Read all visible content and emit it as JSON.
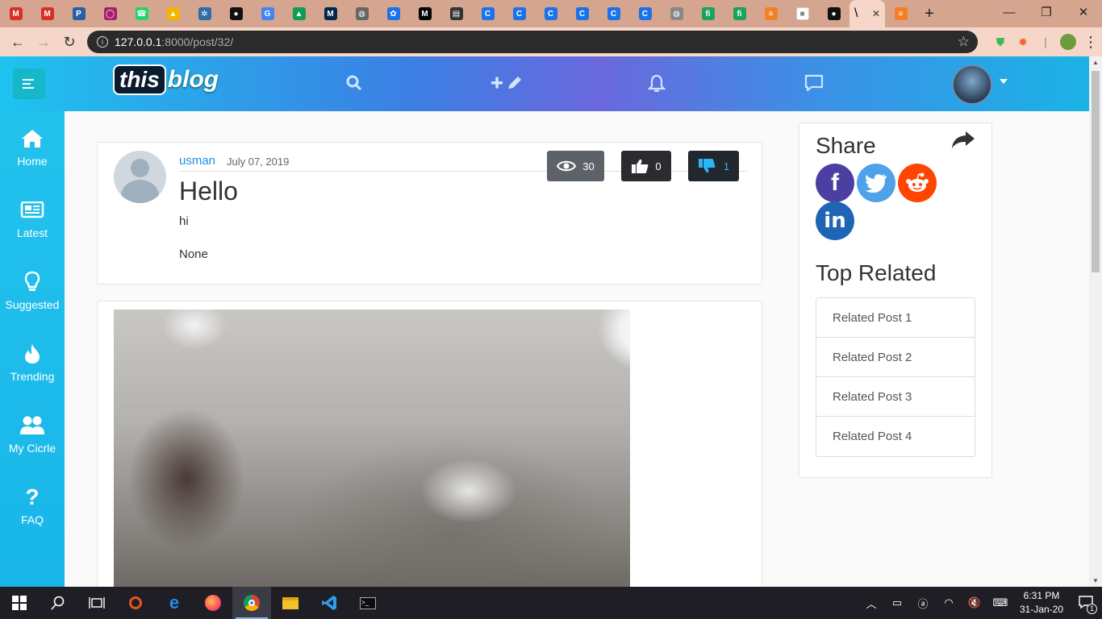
{
  "browser": {
    "tabs": [
      {
        "icon": "gmail-icon",
        "label": "M",
        "color": "#d93025"
      },
      {
        "icon": "gmail-icon",
        "label": "M",
        "color": "#d93025"
      },
      {
        "icon": "pastebin-icon",
        "label": "P",
        "color": "#2a5ea8"
      },
      {
        "icon": "circle-icon",
        "label": "◯",
        "color": "#a61e6c"
      },
      {
        "icon": "whatsapp-icon",
        "label": "☎",
        "color": "#25d366"
      },
      {
        "icon": "drive-icon",
        "label": "▲",
        "color": "#f4b400"
      },
      {
        "icon": "network-icon",
        "label": "✲",
        "color": "#2d6ea8"
      },
      {
        "icon": "github-icon",
        "label": "●",
        "color": "#111111"
      },
      {
        "icon": "google-icon",
        "label": "G",
        "color": "#4285f4"
      },
      {
        "icon": "drive-icon",
        "label": "▲",
        "color": "#0f9d58"
      },
      {
        "icon": "michigan-icon",
        "label": "M",
        "color": "#00274c"
      },
      {
        "icon": "globe-icon",
        "label": "◍",
        "color": "#666666"
      },
      {
        "icon": "paw-icon",
        "label": "✿",
        "color": "#1a73e8"
      },
      {
        "icon": "medium-icon",
        "label": "M",
        "color": "#000000"
      },
      {
        "icon": "news-icon",
        "label": "▤",
        "color": "#333333"
      },
      {
        "icon": "c-icon",
        "label": "C",
        "color": "#1a73e8"
      },
      {
        "icon": "c-icon",
        "label": "C",
        "color": "#1a73e8"
      },
      {
        "icon": "c-icon",
        "label": "C",
        "color": "#1a73e8"
      },
      {
        "icon": "c-icon",
        "label": "C",
        "color": "#1a73e8"
      },
      {
        "icon": "c-icon",
        "label": "C",
        "color": "#1a73e8"
      },
      {
        "icon": "c-icon",
        "label": "C",
        "color": "#1a73e8"
      },
      {
        "icon": "globe-icon",
        "label": "◍",
        "color": "#888888"
      },
      {
        "icon": "fi-icon",
        "label": "fi",
        "color": "#1aa260"
      },
      {
        "icon": "fi-icon",
        "label": "fi",
        "color": "#1aa260"
      },
      {
        "icon": "stack-icon",
        "label": "≡",
        "color": "#f48024"
      },
      {
        "icon": "cube-icon",
        "label": "■",
        "color": "#ffffff"
      },
      {
        "icon": "github-icon",
        "label": "●",
        "color": "#111111"
      }
    ],
    "active_tab": {
      "label": "\\",
      "close": "✕"
    },
    "new_tab": "+",
    "url_host": "127.0.0.1",
    "url_path": ":8000/post/32/"
  },
  "site": {
    "logo_this": "this",
    "logo_blog": "blog",
    "sidebar": [
      {
        "label": "Home",
        "icon": "home-icon",
        "glyph": "⌂"
      },
      {
        "label": "Latest",
        "icon": "newspaper-icon",
        "glyph": "▤"
      },
      {
        "label": "Suggested",
        "icon": "lightbulb-icon",
        "glyph": "💡"
      },
      {
        "label": "Trending",
        "icon": "fire-icon",
        "glyph": "🔥"
      },
      {
        "label": "My Cicrle",
        "icon": "users-icon",
        "glyph": "👥"
      },
      {
        "label": "FAQ",
        "icon": "question-icon",
        "glyph": "?"
      }
    ],
    "post": {
      "author": "usman",
      "date": "July 07, 2019",
      "title": "Hello",
      "body": "hi",
      "extra": "None",
      "views": "30",
      "likes": "0",
      "dislikes": "1"
    },
    "share": {
      "title": "Share",
      "networks": [
        "facebook",
        "twitter",
        "reddit",
        "linkedin"
      ]
    },
    "related": {
      "title": "Top Related",
      "items": [
        "Related Post 1",
        "Related Post 2",
        "Related Post 3",
        "Related Post 4"
      ]
    }
  },
  "taskbar": {
    "time": "6:31 PM",
    "date": "31-Jan-20",
    "notifications": "1"
  }
}
